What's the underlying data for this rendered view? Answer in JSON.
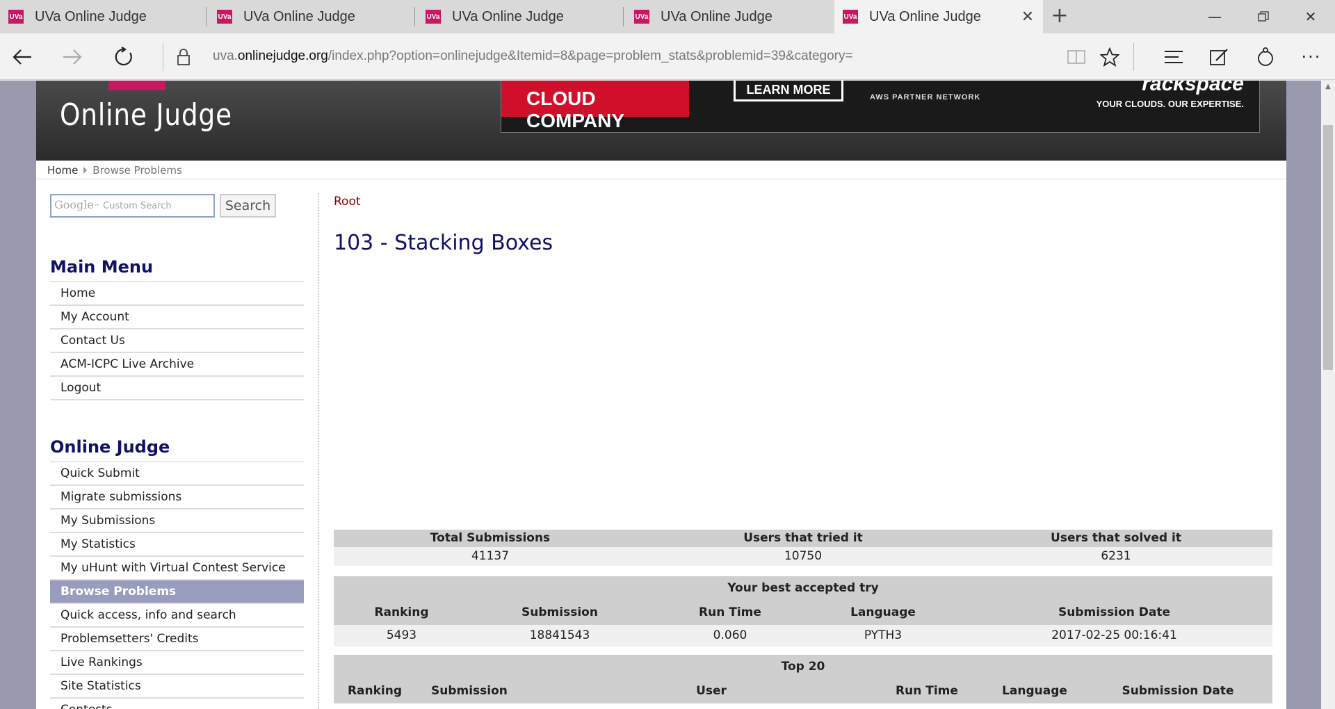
{
  "browser": {
    "tabs": [
      {
        "title": "UVa Online Judge",
        "favicon": "UVa"
      },
      {
        "title": "UVa Online Judge",
        "favicon": "UVa"
      },
      {
        "title": "UVa Online Judge",
        "favicon": "UVa"
      },
      {
        "title": "UVa Online Judge",
        "favicon": "UVa"
      },
      {
        "title": "UVa Online Judge",
        "favicon": "UVa"
      }
    ],
    "url_prefix": "uva.",
    "url_domain": "onlinejudge.org",
    "url_path": "/index.php?option=onlinejudge&Itemid=8&page=problem_stats&problemid=39&category="
  },
  "header": {
    "logo": "Online Judge",
    "ad": {
      "headline": "CLOUD COMPANY",
      "cta": "LEARN MORE",
      "partner": "AWS PARTNER NETWORK",
      "brand": "rackspace",
      "tagline": "YOUR CLOUDS. OUR EXPERTISE."
    }
  },
  "breadcrumb": [
    "Home",
    "Browse Problems"
  ],
  "search": {
    "placeholder": "Custom Search",
    "google": "Google",
    "button": "Search"
  },
  "main_menu": {
    "title": "Main Menu",
    "items": [
      "Home",
      "My Account",
      "Contact Us",
      "ACM-ICPC Live Archive",
      "Logout"
    ]
  },
  "oj_menu": {
    "title": "Online Judge",
    "items": [
      "Quick Submit",
      "Migrate submissions",
      "My Submissions",
      "My Statistics",
      "My uHunt with Virtual Contest Service",
      "Browse Problems",
      "Quick access, info and search",
      "Problemsetters' Credits",
      "Live Rankings",
      "Site Statistics",
      "Contests"
    ]
  },
  "content": {
    "root": "Root",
    "title": "103 - Stacking Boxes",
    "totals": {
      "headers": [
        "Total Submissions",
        "Users that tried it",
        "Users that solved it"
      ],
      "values": [
        "41137",
        "10750",
        "6231"
      ]
    },
    "best": {
      "caption": "Your best accepted try",
      "headers": [
        "Ranking",
        "Submission",
        "Run Time",
        "Language",
        "Submission Date"
      ],
      "values": [
        "5493",
        "18841543",
        "0.060",
        "PYTH3",
        "2017-02-25 00:16:41"
      ]
    },
    "top": {
      "caption": "Top 20",
      "headers": [
        "Ranking",
        "Submission",
        "User",
        "Run Time",
        "Language",
        "Submission Date"
      ]
    }
  }
}
